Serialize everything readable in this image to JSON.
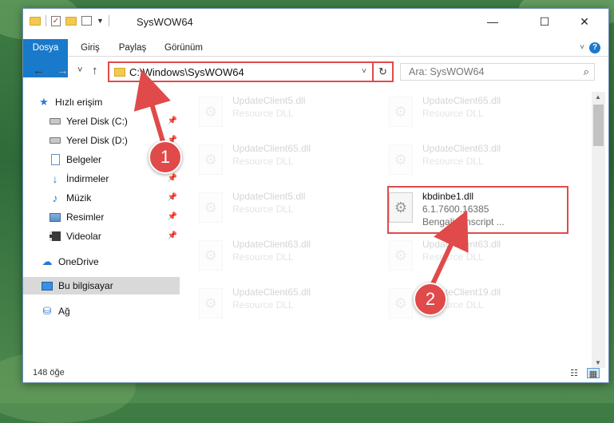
{
  "window": {
    "title": "SysWOW64",
    "controls": {
      "minimize": "—",
      "maximize": "☐",
      "close": "✕"
    }
  },
  "ribbon": {
    "tabs": [
      {
        "label": "Dosya",
        "active": true
      },
      {
        "label": "Giriş"
      },
      {
        "label": "Paylaş"
      },
      {
        "label": "Görünüm"
      }
    ],
    "help": "?"
  },
  "navigation": {
    "back": "←",
    "forward": "→",
    "recent": "˅",
    "up": "↑",
    "address": "C:\\Windows\\SysWOW64",
    "address_dropdown": "˅",
    "refresh": "↻",
    "search_placeholder": "Ara: SysWOW64"
  },
  "sidebar": {
    "items": [
      {
        "label": "Hızlı erişim",
        "icon": "star-icon"
      },
      {
        "label": "Yerel Disk (C:)",
        "icon": "disk-icon",
        "pinned": true
      },
      {
        "label": "Yerel Disk (D:)",
        "icon": "disk-icon",
        "pinned": true
      },
      {
        "label": "Belgeler",
        "icon": "document-icon",
        "pinned": true
      },
      {
        "label": "İndirmeler",
        "icon": "download-icon",
        "pinned": true
      },
      {
        "label": "Müzik",
        "icon": "music-icon",
        "pinned": true
      },
      {
        "label": "Resimler",
        "icon": "pictures-icon",
        "pinned": true
      },
      {
        "label": "Videolar",
        "icon": "video-icon",
        "pinned": true
      },
      {
        "label": "OneDrive",
        "icon": "cloud-icon"
      },
      {
        "label": "Bu bilgisayar",
        "icon": "computer-icon",
        "selected": true
      },
      {
        "label": "Ağ",
        "icon": "network-icon"
      }
    ]
  },
  "files": [
    {
      "name": "UpdateClient5.dll",
      "description": "Resource DLL"
    },
    {
      "name": "UpdateClient65.dll",
      "description": "Resource DLL"
    },
    {
      "name": "UpdateClient65.dll",
      "description": "Resource DLL"
    },
    {
      "name": "UpdateClient63.dll",
      "description": "Resource DLL"
    },
    {
      "name": "UpdateClient5.dll",
      "description": "Resource DLL"
    },
    {
      "name": "kbdinbe1.dll",
      "description": "6.1.7600.16385",
      "description2": "Bengali - Inscript ...",
      "highlighted": true
    },
    {
      "name": "UpdateClient63.dll",
      "description": "Resource DLL"
    },
    {
      "name": "UpdateClient63.dll",
      "description": "Resource DLL"
    },
    {
      "name": "UpdateClient65.dll",
      "description": "Resource DLL"
    },
    {
      "name": "UpdateClient19.dll",
      "description": "Resource DLL"
    }
  ],
  "status": {
    "item_count": "148 öğe"
  },
  "callouts": [
    "1",
    "2"
  ],
  "colors": {
    "accent": "#1979ca",
    "highlight": "#e04a4a"
  }
}
